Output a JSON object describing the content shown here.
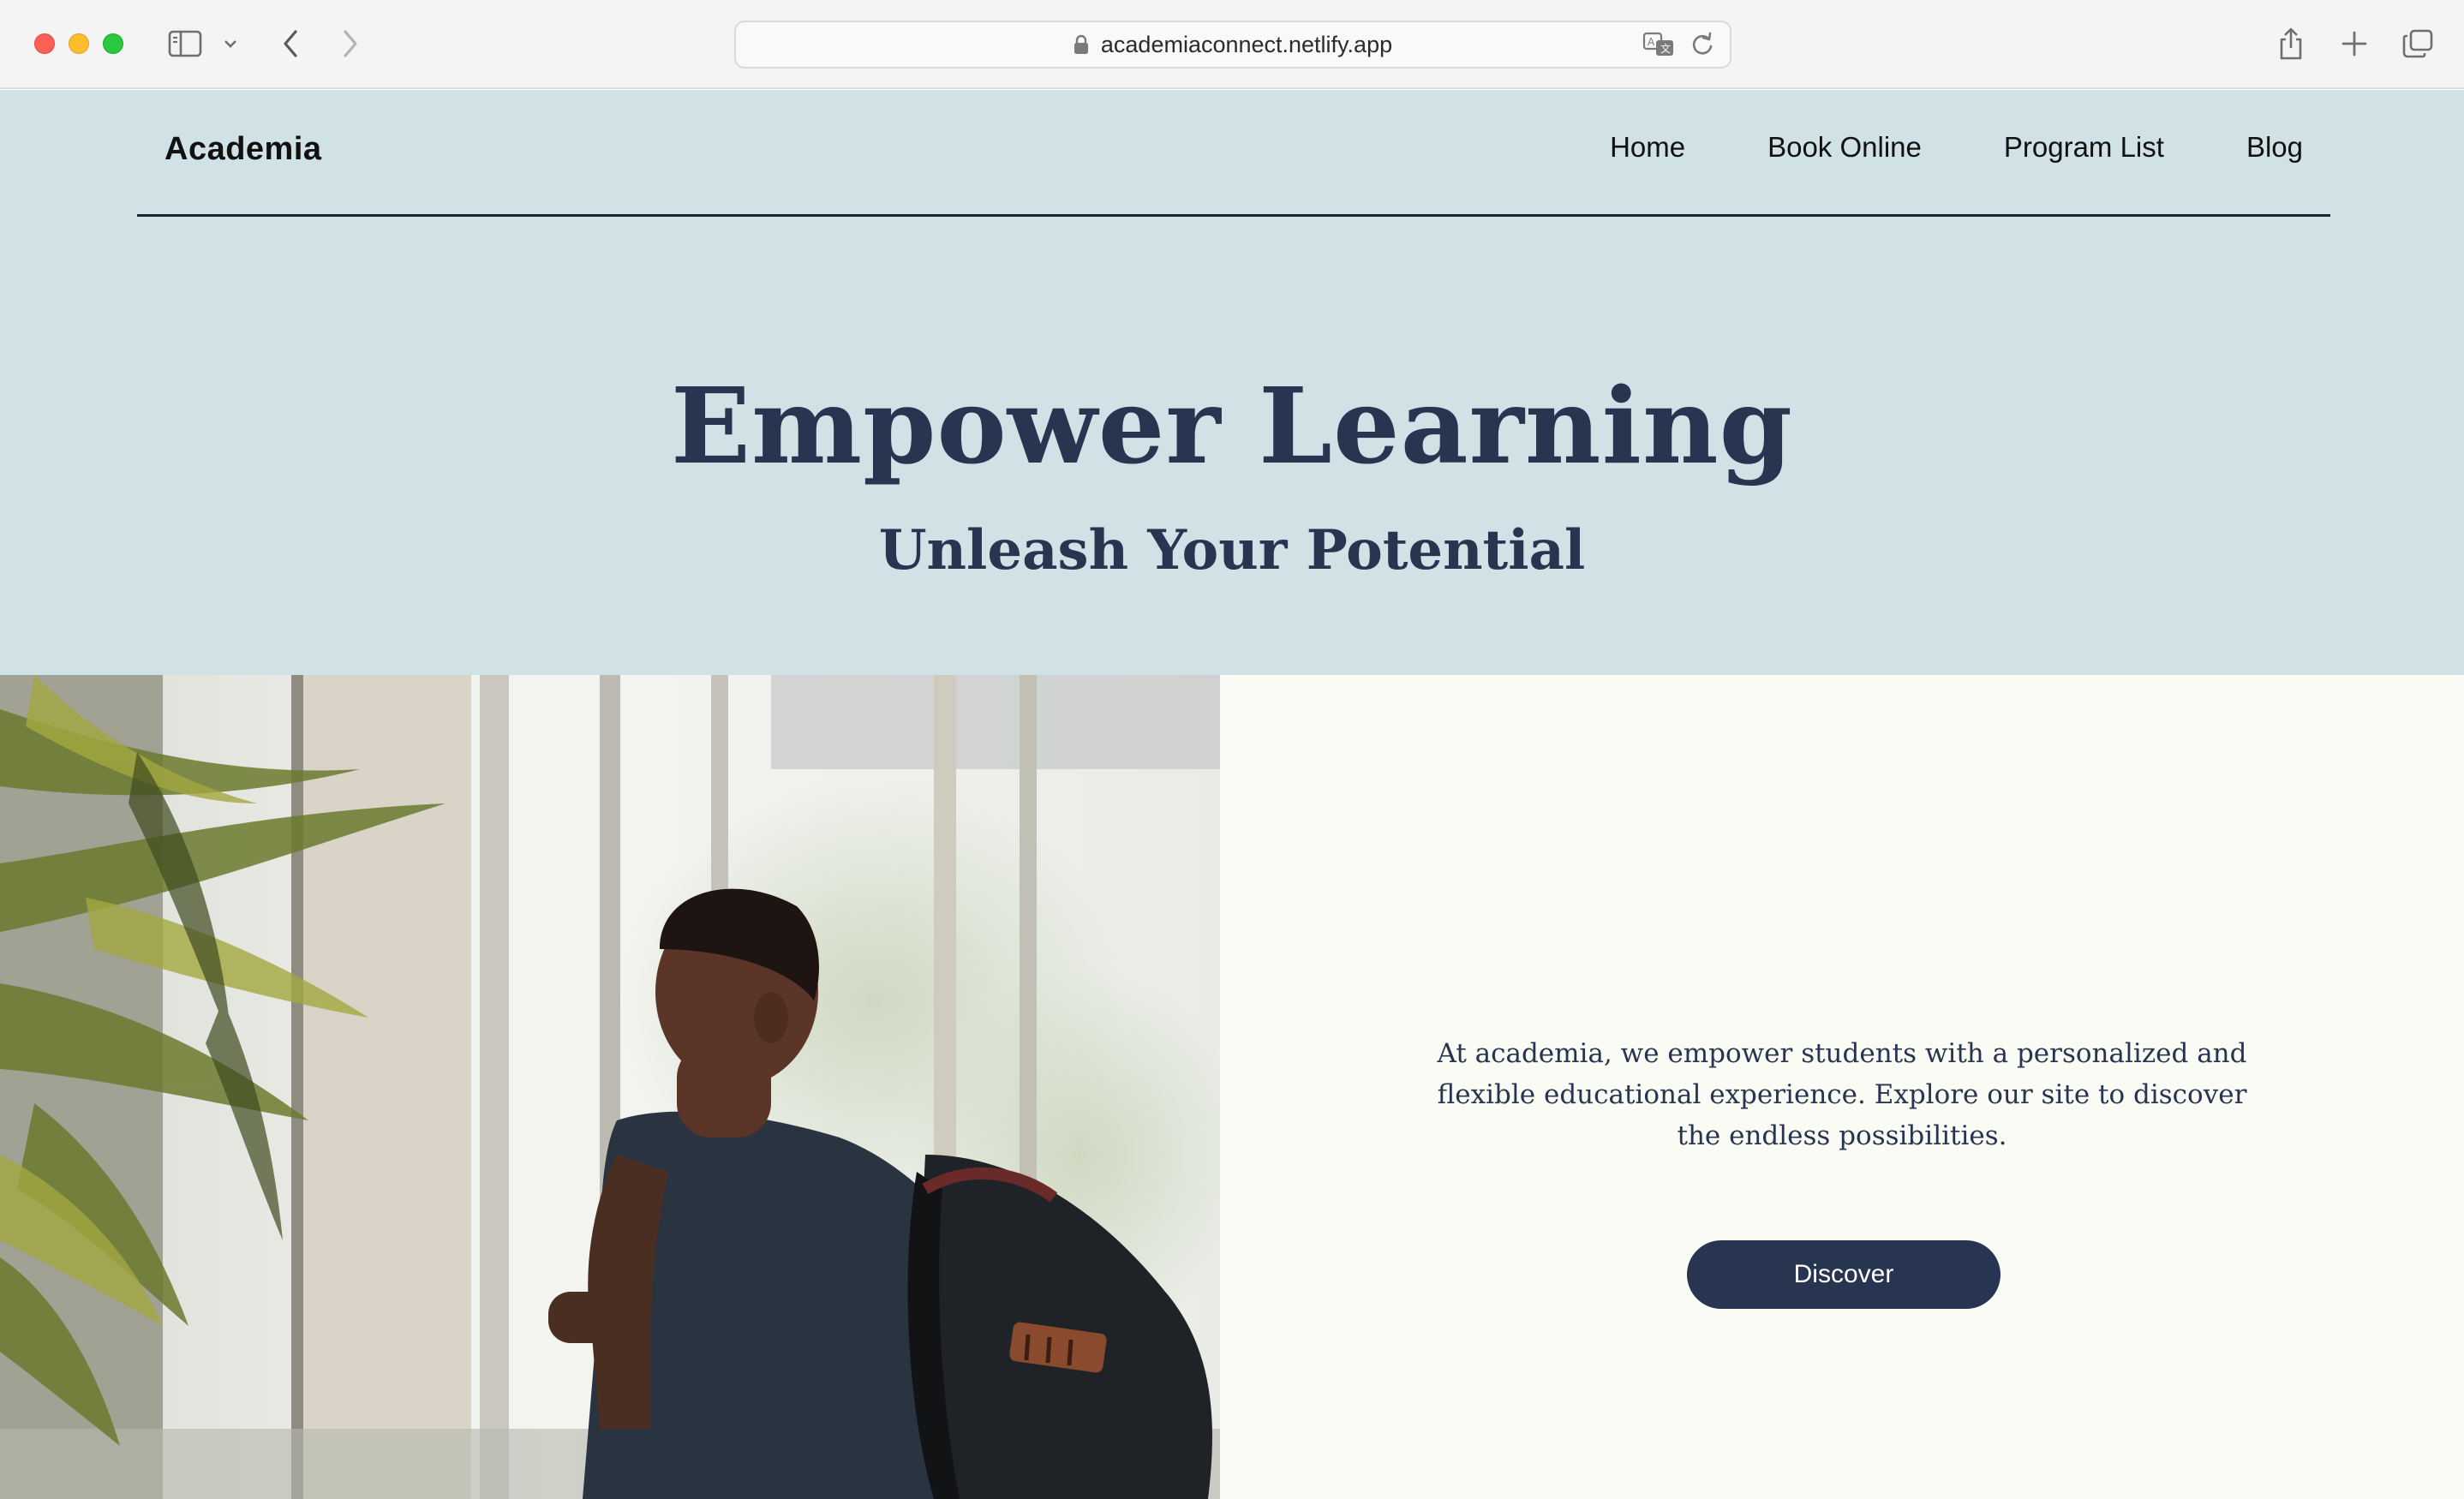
{
  "browser": {
    "url": "academiaconnect.netlify.app",
    "icons": [
      "sidebar-icon",
      "chevron-down-icon",
      "back-icon",
      "forward-icon",
      "lock-icon",
      "translate-icon",
      "reload-icon",
      "share-icon",
      "new-tab-icon",
      "tabs-overview-icon"
    ]
  },
  "site": {
    "brand": "Academia",
    "nav": [
      "Home",
      "Book Online",
      "Program List",
      "Blog"
    ]
  },
  "hero": {
    "title": "Empower Learning",
    "subtitle": "Unleash Your Potential"
  },
  "about": {
    "text": "At academia, we empower students with a personalized and flexible educational experience. Explore our site to discover the endless possibilities.",
    "button": "Discover"
  },
  "colors": {
    "hero_bg": "#d0e2e6",
    "content_bg": "#fbfbf5",
    "navy": "#283551"
  }
}
